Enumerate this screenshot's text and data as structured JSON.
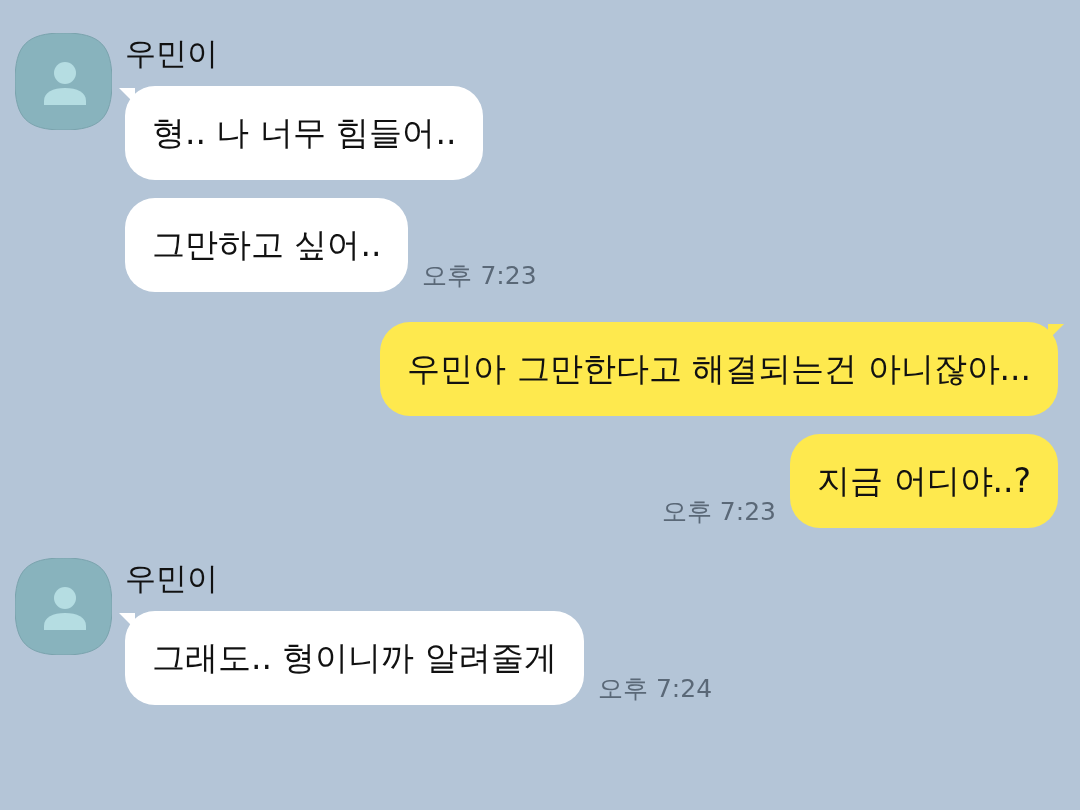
{
  "groups": [
    {
      "kind": "incoming",
      "sender": "우민이",
      "bubbles": [
        "형.. 나 너무 힘들어..",
        "그만하고 싶어.."
      ],
      "time": "오후 7:23"
    },
    {
      "kind": "outgoing",
      "bubbles": [
        "우민아 그만한다고 해결되는건 아니잖아...",
        "지금 어디야..?"
      ],
      "time": "오후 7:23"
    },
    {
      "kind": "incoming",
      "sender": "우민이",
      "bubbles": [
        "그래도.. 형이니까 알려줄게"
      ],
      "time": "오후 7:24"
    }
  ]
}
